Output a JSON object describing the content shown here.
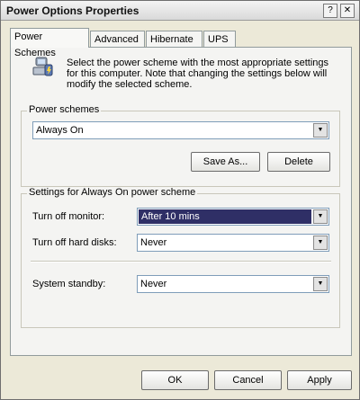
{
  "window": {
    "title": "Power Options Properties"
  },
  "titlebar": {
    "help": "?",
    "close": "✕"
  },
  "tabs": [
    {
      "label": "Power Schemes"
    },
    {
      "label": "Advanced"
    },
    {
      "label": "Hibernate"
    },
    {
      "label": "UPS"
    }
  ],
  "intro": {
    "text": "Select the power scheme with the most appropriate settings for this computer. Note that changing the settings below will modify the selected scheme."
  },
  "schemes": {
    "group_label": "Power schemes",
    "selected": "Always On",
    "save_as": "Save As...",
    "delete": "Delete"
  },
  "settings": {
    "group_label": "Settings for Always On power scheme",
    "monitor": {
      "label": "Turn off monitor:",
      "value": "After 10 mins"
    },
    "hard_disks": {
      "label": "Turn off hard disks:",
      "value": "Never"
    },
    "standby": {
      "label": "System standby:",
      "value": "Never"
    }
  },
  "footer": {
    "ok": "OK",
    "cancel": "Cancel",
    "apply": "Apply"
  },
  "icons": {
    "dropdown": "▼"
  }
}
